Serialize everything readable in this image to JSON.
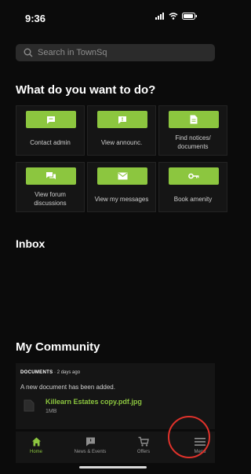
{
  "status": {
    "time": "9:36"
  },
  "search": {
    "placeholder": "Search in TownSq"
  },
  "actions": {
    "heading": "What do you want to do?",
    "tiles": [
      {
        "label": "Contact admin",
        "icon": "chat-bubble-icon"
      },
      {
        "label": "View announc.",
        "icon": "announcement-icon"
      },
      {
        "label": "Find notices/ documents",
        "icon": "document-icon"
      },
      {
        "label": "View forum discussions",
        "icon": "forum-icon"
      },
      {
        "label": "View my messages",
        "icon": "envelope-icon"
      },
      {
        "label": "Book amenity",
        "icon": "key-icon"
      }
    ]
  },
  "inbox": {
    "heading": "Inbox"
  },
  "community": {
    "heading": "My Community",
    "card": {
      "category": "DOCUMENTS",
      "time": " · 2 days ago",
      "text": "A new document has been added.",
      "file_name": "Killearn Estates copy.pdf.jpg",
      "file_size": "1MB"
    }
  },
  "tabbar": {
    "items": [
      {
        "label": "Home",
        "icon": "home-icon",
        "active": true
      },
      {
        "label": "News & Events",
        "icon": "news-icon",
        "active": false
      },
      {
        "label": "Offers",
        "icon": "cart-icon",
        "active": false
      },
      {
        "label": "Menu",
        "icon": "menu-icon",
        "active": false
      }
    ]
  },
  "colors": {
    "accent": "#8cc63f",
    "background": "#0b0b0b",
    "card": "#151515",
    "highlight_circle": "#e0322b"
  }
}
